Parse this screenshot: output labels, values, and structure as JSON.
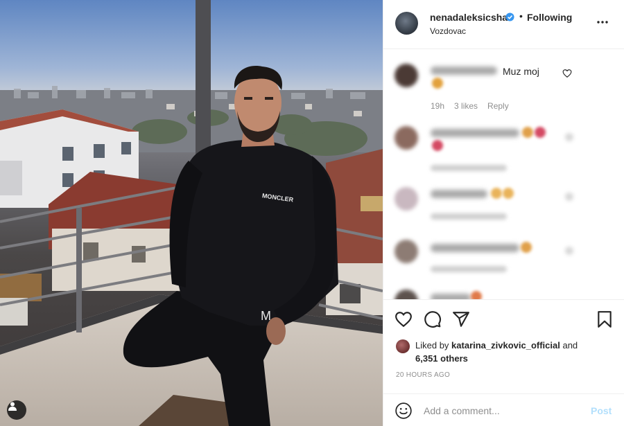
{
  "post": {
    "username": "nenadaleksicsha",
    "follow_status": "Following",
    "location": "Vozdovac",
    "sweater_logo_text": "MONCLER"
  },
  "comments": [
    {
      "text": "Muz moj",
      "time": "19h",
      "likes": "3 likes",
      "reply": "Reply"
    }
  ],
  "likes": {
    "prefix": "Liked by ",
    "user": "katarina_zivkovic_official",
    "and": " and",
    "others": "6,351 others"
  },
  "timestamp": "20 HOURS AGO",
  "add_comment": {
    "placeholder": "Add a comment...",
    "post_label": "Post"
  },
  "icons": {
    "more": "more-options-icon",
    "heart": "heart-icon",
    "comment": "comment-icon",
    "share": "share-icon",
    "save": "bookmark-icon",
    "emoji": "emoji-icon",
    "user_tags": "user-tags-icon",
    "verified": "verified-badge-icon"
  },
  "colors": {
    "link_disabled": "#b2dffc",
    "verified": "#3897f0",
    "text": "#262626",
    "meta": "#8e8e8e"
  }
}
